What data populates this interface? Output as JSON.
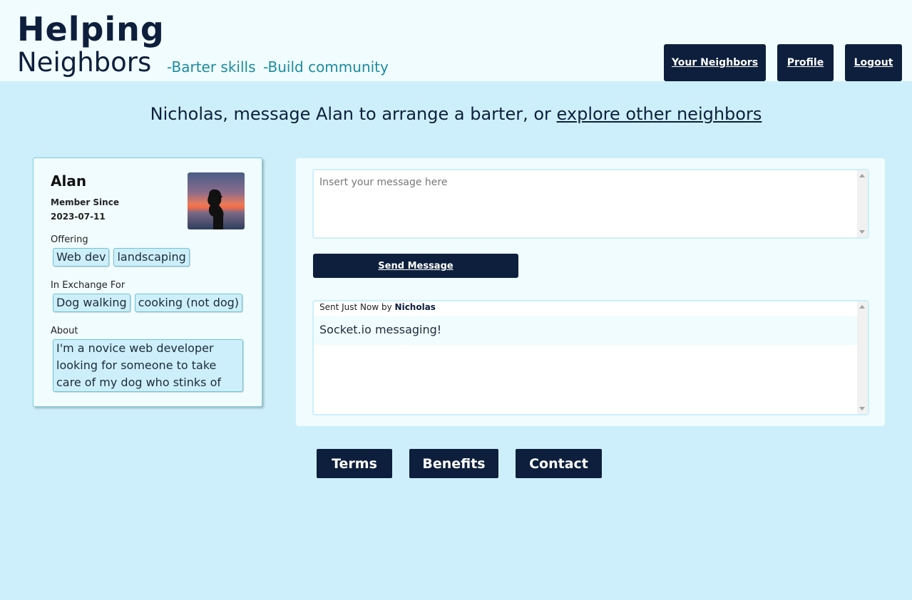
{
  "header": {
    "brand_line1": "Helping",
    "brand_line2": "Neighbors",
    "tagline1": "-Barter skills",
    "tagline2": "-Build community",
    "nav": {
      "your_neighbors": "Your Neighbors",
      "profile": "Profile",
      "logout": "Logout"
    }
  },
  "headline": {
    "text": "Nicholas, message Alan to arrange a barter, or ",
    "link": "explore other neighbors"
  },
  "profile_card": {
    "name": "Alan",
    "member_since_label": "Member Since",
    "member_since_date": "2023-07-11",
    "offering_label": "Offering",
    "offering": [
      "Web dev",
      "landscaping"
    ],
    "exchange_label": "In Exchange For",
    "exchange": [
      "Dog walking",
      "cooking (not dog)"
    ],
    "about_label": "About",
    "about": "I'm a novice web developer looking for someone to take care of my dog who stinks of corn"
  },
  "message_panel": {
    "input_placeholder": "Insert your message here",
    "send_label": "Send Message",
    "messages": [
      {
        "meta_prefix": "Sent Just Now by ",
        "sender": "Nicholas",
        "body": "Socket.io messaging!"
      }
    ]
  },
  "footer": {
    "terms": "Terms",
    "benefits": "Benefits",
    "contact": "Contact"
  },
  "colors": {
    "page_bg": "#cdeffb",
    "header_bg": "#f1fcfe",
    "navy": "#0d1f3c",
    "teal_accent": "#1a8ca0"
  }
}
